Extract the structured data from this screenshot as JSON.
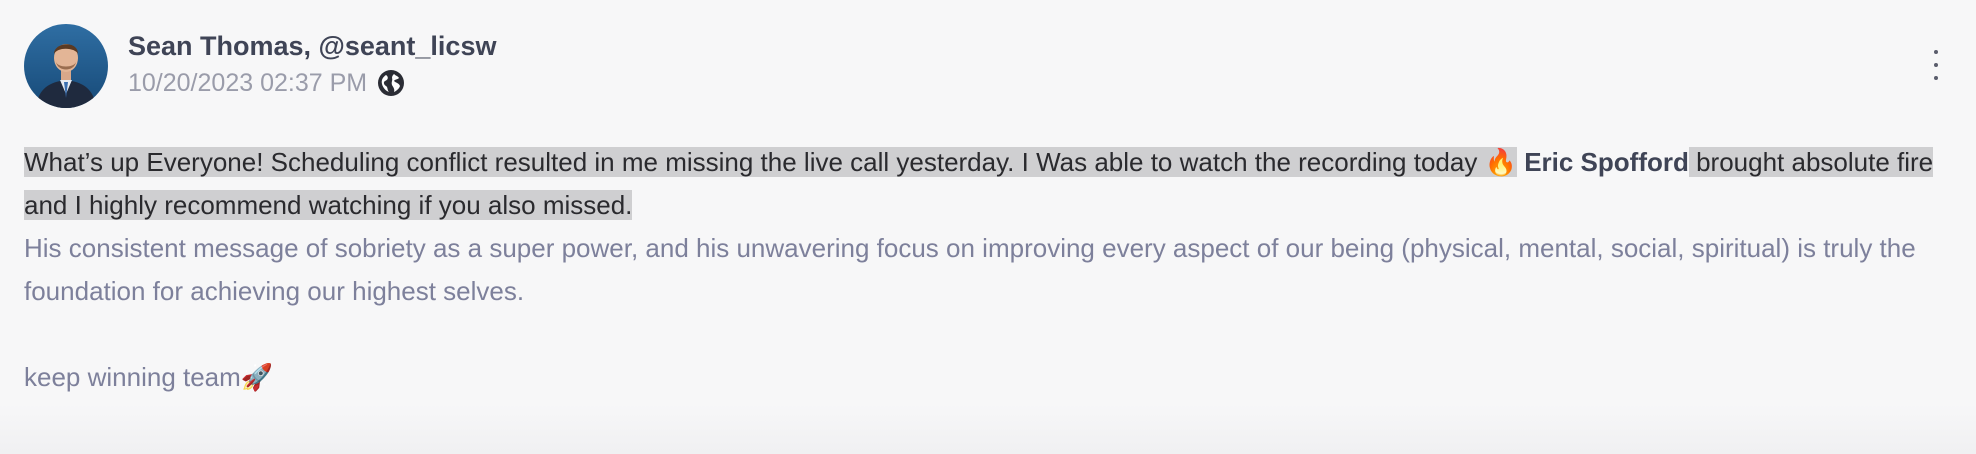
{
  "post": {
    "author": "Sean Thomas, @seant_licsw",
    "timestamp": "10/20/2023 02:37 PM",
    "visibility_icon": "globe-icon",
    "menu_icon": "more-vertical-icon",
    "body": {
      "line1_part1": "What’s up Everyone! Scheduling conflict resulted in me missing the live call yesterday. I Was able to watch the recording today 🔥",
      "mention": "Eric Spofford",
      "line1_part2": " brought absolute fire and I highly recommend watching if you also missed.",
      "paragraph2": "His consistent message of sobriety as a super power, and his unwavering focus on improving every aspect of our being (physical, mental, social, spiritual) is truly the foundation for achieving our highest selves.",
      "paragraph3": "keep winning team🚀"
    }
  },
  "colors": {
    "background": "#f7f7f8",
    "highlight": "#cfcfd1",
    "author_text": "#3f4456",
    "muted_text": "#7d809b",
    "timestamp_text": "#9a9caa"
  }
}
